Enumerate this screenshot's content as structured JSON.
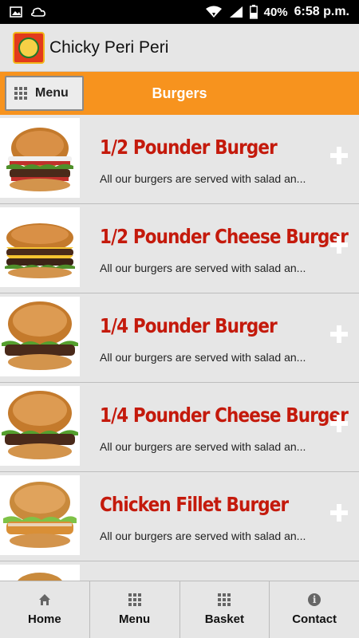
{
  "status_bar": {
    "battery": "40%",
    "time": "6:58 p.m.",
    "icons": [
      "image-icon",
      "cloud-icon",
      "wifi-icon",
      "signal-icon",
      "battery-icon"
    ]
  },
  "app_bar": {
    "title": "Chicky Peri Peri",
    "logo": "app-logo"
  },
  "category_bar": {
    "menu_label": "Menu",
    "title": "Burgers",
    "accent_color": "#f7931e"
  },
  "items": [
    {
      "name": "1/2 Pounder Burger",
      "desc": "All our burgers are served with salad an...",
      "image": "burger-image"
    },
    {
      "name": "1/2 Pounder Cheese Burger",
      "desc": "All our burgers are served with salad an...",
      "image": "cheese-burger-image"
    },
    {
      "name": "1/4 Pounder Burger",
      "desc": "All our burgers are served with salad an...",
      "image": "burger-image"
    },
    {
      "name": "1/4 Pounder Cheese Burger",
      "desc": "All our burgers are served with salad an...",
      "image": "burger-image"
    },
    {
      "name": "Chicken Fillet Burger",
      "desc": "All our burgers are served with salad an...",
      "image": "chicken-burger-image"
    }
  ],
  "bottom_nav": [
    {
      "label": "Home",
      "icon": "home-icon"
    },
    {
      "label": "Menu",
      "icon": "grid-icon"
    },
    {
      "label": "Basket",
      "icon": "grid-icon"
    },
    {
      "label": "Contact",
      "icon": "info-icon"
    }
  ],
  "colors": {
    "item_title": "#c41a0c",
    "header_bg": "#f7931e"
  }
}
